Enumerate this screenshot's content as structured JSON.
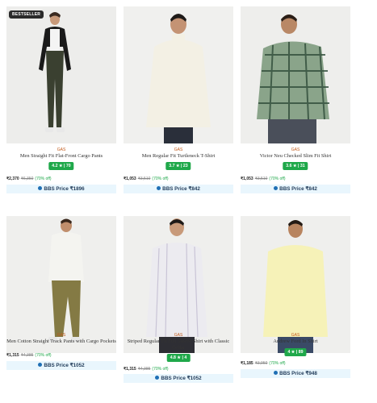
{
  "products": [
    {
      "badge": "BESTSELLER",
      "brand": "GAS",
      "name": "Men Straight Fit Flat-Front Cargo Pants",
      "rating": "4.2 ★ | 70",
      "price": "₹2,370",
      "mrp": "₹6,350",
      "discount": "(70% off)",
      "bbs": "BBS Price ₹1896"
    },
    {
      "brand": "GAS",
      "name": "Men Regular Fit Turtleneck T-Shirt",
      "rating": "3.7 ★ | 23",
      "price": "₹1,053",
      "mrp": "₹3,510",
      "discount": "(70% off)",
      "bbs": "BBS Price ₹842"
    },
    {
      "brand": "GAS",
      "name": "Victor Neu Checked Slim Fit Shirt",
      "rating": "3.6 ★ | 31",
      "price": "₹1,053",
      "mrp": "₹3,510",
      "discount": "(70% off)",
      "bbs": "BBS Price ₹842"
    },
    {
      "brand": "GAS",
      "name": "Men Cotton Straight Track Pants with Cargo Pockets",
      "price": "₹1,315",
      "mrp": "₹4,385",
      "discount": "(70% off)",
      "bbs": "BBS Price ₹1052"
    },
    {
      "brand": "GAS",
      "name": "Striped Regular Fit Full Sleeve Shirt with Classic Collar",
      "rating": "4.8 ★ | 4",
      "price": "₹1,315",
      "mrp": "₹4,385",
      "discount": "(70% off)",
      "bbs": "BBS Price ₹1052"
    },
    {
      "brand": "GAS",
      "name": "Andrew Ford In Shirt",
      "rating": "4 ★ | 89",
      "price": "₹1,185",
      "mrp": "₹3,950",
      "discount": "(70% off)",
      "bbs": "BBS Price ₹948"
    }
  ],
  "colors": {
    "rating_bg": "#1fa84a",
    "brand": "#c35a1a",
    "bbs_bg": "#e9f6fd",
    "bbs_text": "#1f3a58"
  },
  "icons": [
    "bbs-coin-icon"
  ]
}
